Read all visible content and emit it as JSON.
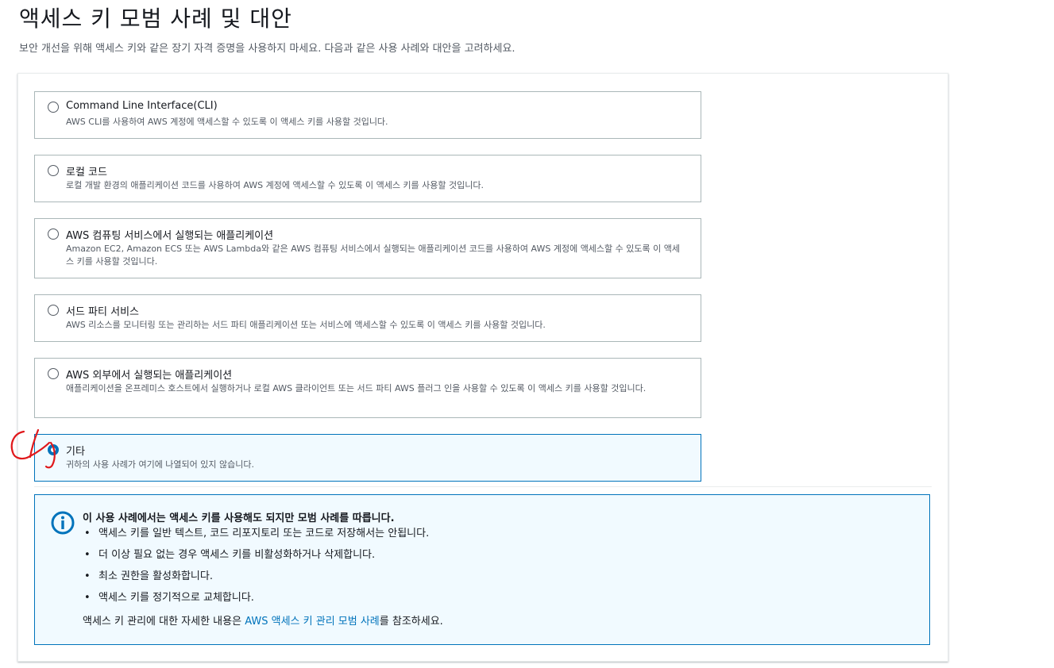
{
  "page": {
    "title": "액세스 키 모범 사례 및 대안",
    "description": "보안 개선을 위해 액세스 키와 같은 장기 자격 증명을 사용하지 마세요. 다음과 같은 사용 사례와 대안을 고려하세요."
  },
  "options": [
    {
      "label": "Command Line Interface(CLI)",
      "description": "AWS CLI를 사용하여 AWS 계정에 액세스할 수 있도록 이 액세스 키를 사용할 것입니다.",
      "selected": false
    },
    {
      "label": "로컬 코드",
      "description": "로컬 개발 환경의 애플리케이션 코드를 사용하여 AWS 계정에 액세스할 수 있도록 이 액세스 키를 사용할 것입니다.",
      "selected": false
    },
    {
      "label": "AWS 컴퓨팅 서비스에서 실행되는 애플리케이션",
      "description": "Amazon EC2, Amazon ECS 또는 AWS Lambda와 같은 AWS 컴퓨팅 서비스에서 실행되는 애플리케이션 코드를 사용하여 AWS 계정에 액세스할 수 있도록 이 액세스 키를 사용할 것입니다.",
      "selected": false
    },
    {
      "label": "서드 파티 서비스",
      "description": "AWS 리소스를 모니터링 또는 관리하는 서드 파티 애플리케이션 또는 서비스에 액세스할 수 있도록 이 액세스 키를 사용할 것입니다.",
      "selected": false
    },
    {
      "label": "AWS 외부에서 실행되는 애플리케이션",
      "description": "애플리케이션을 온프레미스 호스트에서 실행하거나 로컬 AWS 클라이언트 또는 서드 파티 AWS 플러그 인을 사용할 수 있도록 이 액세스 키를 사용할 것입니다.",
      "selected": false
    },
    {
      "label": "기타",
      "description": "귀하의 사용 사례가 여기에 나열되어 있지 않습니다.",
      "selected": true
    }
  ],
  "info": {
    "title": "이 사용 사례에서는 액세스 키를 사용해도 되지만 모범 사례를 따릅니다.",
    "bullets": [
      "액세스 키를 일반 텍스트, 코드 리포지토리 또는 코드로 저장해서는 안됩니다.",
      "더 이상 필요 없는 경우 액세스 키를 비활성화하거나 삭제합니다.",
      "최소 권한을 활성화합니다.",
      "액세스 키를 정기적으로 교체합니다."
    ],
    "footer_prefix": "액세스 키 관리에 대한 자세한 내용은 ",
    "footer_link": "AWS 액세스 키 관리 모범 사례",
    "footer_suffix": "를 참조하세요."
  },
  "colors": {
    "accent": "#0073bb",
    "selected_bg": "#f1faff",
    "border": "#aab7b8",
    "annotation": "#e0181b"
  },
  "icons": {
    "info": "info-circle-icon"
  }
}
